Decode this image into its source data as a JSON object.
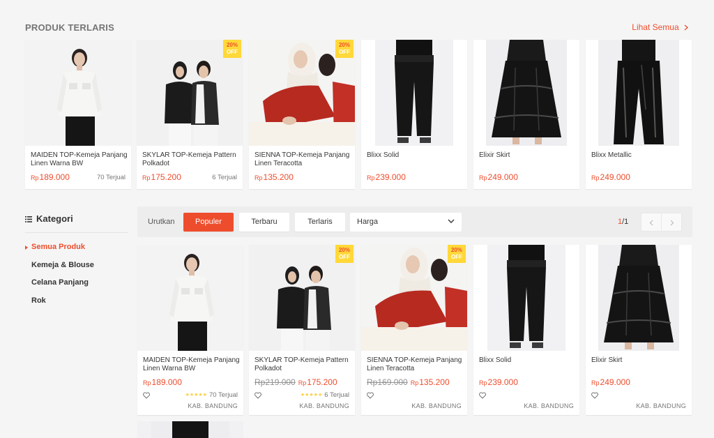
{
  "top_section": {
    "title": "PRODUK TERLARIS",
    "see_all": "Lihat Semua"
  },
  "currency": "Rp",
  "discount_badge": {
    "pct": "20%",
    "off": "OFF"
  },
  "bestsellers": [
    {
      "name": "MAIDEN TOP-Kemeja Panjang Linen Warna BW",
      "price": "189.000",
      "sold": "70 Terjual",
      "discount": false
    },
    {
      "name": "SKYLAR TOP-Kemeja Pattern Polkadot",
      "price": "175.200",
      "sold": "6 Terjual",
      "discount": true
    },
    {
      "name": "SIENNA TOP-Kemeja Panjang Linen Teracotta",
      "price": "135.200",
      "sold": "",
      "discount": true
    },
    {
      "name": "Blixx Solid",
      "price": "239.000",
      "sold": "",
      "discount": false
    },
    {
      "name": "Elixir Skirt",
      "price": "249.000",
      "sold": "",
      "discount": false
    },
    {
      "name": "Blixx Metallic",
      "price": "249.000",
      "sold": "",
      "discount": false
    }
  ],
  "sidebar": {
    "title": "Kategori",
    "items": [
      {
        "label": "Semua Produk",
        "active": true
      },
      {
        "label": "Kemeja & Blouse",
        "active": false
      },
      {
        "label": "Celana Panjang",
        "active": false
      },
      {
        "label": "Rok",
        "active": false
      }
    ]
  },
  "sortbar": {
    "label": "Urutkan",
    "options": [
      "Populer",
      "Terbaru",
      "Terlaris"
    ],
    "active": "Populer",
    "price_select": "Harga",
    "page_current": "1",
    "page_total": "/1"
  },
  "products": [
    {
      "name": "MAIDEN TOP-Kemeja Panjang Linen Warna BW",
      "price": "189.000",
      "original": "",
      "sold": "70 Terjual",
      "rating": 5,
      "location": "KAB. BANDUNG",
      "discount": false
    },
    {
      "name": "SKYLAR TOP-Kemeja Pattern Polkadot",
      "price": "175.200",
      "original": "Rp219.000",
      "sold": "6 Terjual",
      "rating": 5,
      "location": "KAB. BANDUNG",
      "discount": true
    },
    {
      "name": "SIENNA TOP-Kemeja Panjang Linen Teracotta",
      "price": "135.200",
      "original": "Rp169.000",
      "sold": "",
      "rating": 0,
      "location": "KAB. BANDUNG",
      "discount": true
    },
    {
      "name": "Blixx Solid",
      "price": "239.000",
      "original": "",
      "sold": "",
      "rating": 0,
      "location": "KAB. BANDUNG",
      "discount": false
    },
    {
      "name": "Elixir Skirt",
      "price": "249.000",
      "original": "",
      "sold": "",
      "rating": 0,
      "location": "KAB. BANDUNG",
      "discount": false
    }
  ],
  "colors": {
    "accent": "#ee4d2d",
    "badge": "#ffd839",
    "star": "#ffce3d"
  },
  "icons": [
    "list-icon",
    "chevron-right-icon",
    "chevron-down-icon",
    "chevron-left-icon",
    "heart-icon",
    "star-icon"
  ]
}
